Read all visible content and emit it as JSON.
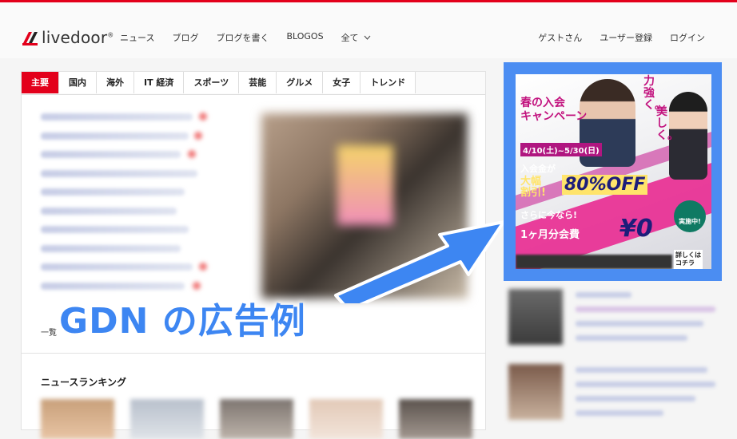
{
  "header": {
    "logo_text": "livedoor",
    "logo_mark": "®",
    "nav": [
      "ニュース",
      "ブログ",
      "ブログを書く",
      "BLOGOS",
      "全て"
    ],
    "right_nav": [
      "ゲストさん",
      "ユーザー登録",
      "ログイン"
    ]
  },
  "tabs": [
    "主要",
    "国内",
    "海外",
    "IT 経済",
    "スポーツ",
    "芸能",
    "グルメ",
    "女子",
    "トレンド"
  ],
  "news": {
    "more_label": "一覧",
    "ranking_title": "ニュースランキング"
  },
  "annotation": {
    "label": "GDN の広告例"
  },
  "ad": {
    "campaign": "春の入会\nキャンペーン",
    "dates": "4/10(土)~5/30(日)",
    "tag_power": "力強く。",
    "tag_beauty": "美しく。",
    "fee_label": "入会金が",
    "big_label": "大幅\n割引!",
    "discount": "80%OFF",
    "now_label": "さらに今なら!",
    "month_label": "1ヶ月分会費",
    "zero": "¥0",
    "badge": "実施中!",
    "cta": "詳しくは\nコチラ"
  },
  "colors": {
    "accent": "#e3001b",
    "annotation": "#3d86f2",
    "ad_frame": "#4b8df2",
    "ad_pink": "#c2127e"
  }
}
